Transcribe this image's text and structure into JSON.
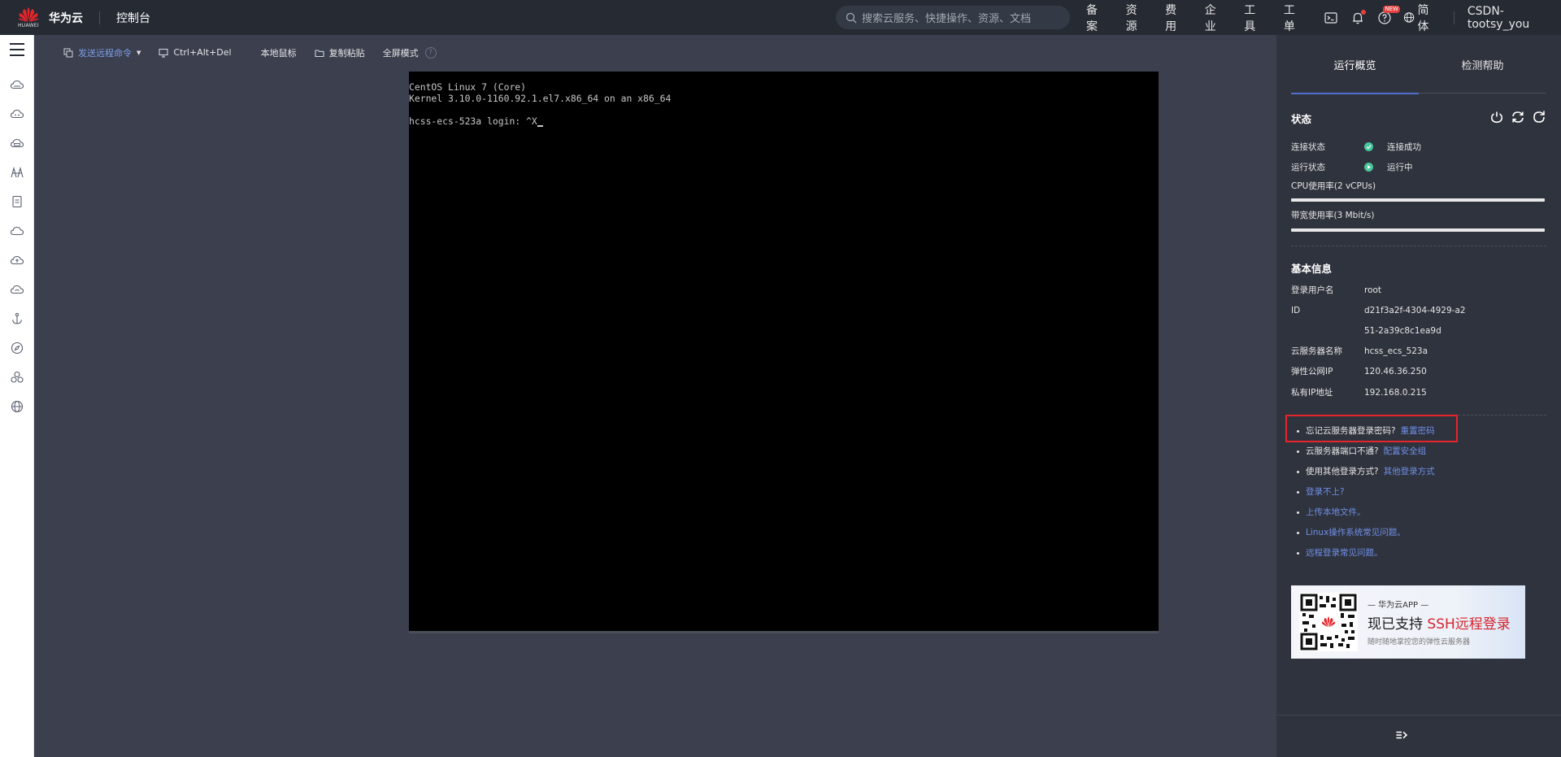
{
  "header": {
    "brand": "华为云",
    "logo_text": "HUAWEI",
    "console": "控制台",
    "search_placeholder": "搜索云服务、快捷操作、资源、文档",
    "nav": [
      "备案",
      "资源",
      "费用",
      "企业",
      "工具",
      "工单"
    ],
    "icons": [
      "terminal-icon",
      "bell-icon",
      "help-icon"
    ],
    "new_badge": "NEW",
    "language": "简体",
    "user": "CSDN-tootsy_you"
  },
  "sidebar": {
    "icons": [
      "menu-icon",
      "cloud-icon",
      "cloud-icon",
      "cloud-storage-icon",
      "network-icon",
      "document-icon",
      "cloud-icon",
      "cloud-upload-icon",
      "cloud-download-icon",
      "anchor-icon",
      "compass-icon",
      "cluster-icon",
      "globe-icon"
    ]
  },
  "toolbar": {
    "send_command": "发送远程命令",
    "ctrl_alt_del": "Ctrl+Alt+Del",
    "local_mouse": "本地鼠标",
    "copy_paste": "复制粘贴",
    "fullscreen": "全屏模式",
    "help": "?"
  },
  "terminal": {
    "line1": "CentOS Linux 7 (Core)",
    "line2": "Kernel 3.10.0-1160.92.1.el7.x86_64 on an x86_64",
    "line3": "",
    "line4": "hcss-ecs-523a login: ^X"
  },
  "panel": {
    "tabs": [
      "运行概览",
      "检测帮助"
    ],
    "status_title": "状态",
    "connection_label": "连接状态",
    "connection_value": "连接成功",
    "running_label": "运行状态",
    "running_value": "运行中",
    "cpu_label": "CPU使用率(2 vCPUs)",
    "cpu_usage": 0.0,
    "bandwidth_label": "带宽使用率(3 Mbit/s)",
    "bandwidth_usage": 0.0,
    "basic_title": "基本信息",
    "info": [
      {
        "k": "登录用户名",
        "v": "root"
      },
      {
        "k": "ID",
        "v": "d21f3a2f-4304-4929-a251-2a39c8c1ea9d"
      },
      {
        "k": "云服务器名称",
        "v": "hcss_ecs_523a"
      },
      {
        "k": "弹性公网IP",
        "v": "120.46.36.250"
      },
      {
        "k": "私有IP地址",
        "v": "192.168.0.215"
      }
    ],
    "tips": [
      {
        "q": "忘记云服务器登录密码?",
        "link": "重置密码"
      },
      {
        "q": "云服务器端口不通?",
        "link": "配置安全组"
      },
      {
        "q": "使用其他登录方式?",
        "link": "其他登录方式"
      },
      {
        "q": "",
        "link": "登录不上?"
      },
      {
        "q": "",
        "link": "上传本地文件。"
      },
      {
        "q": "",
        "link": "Linux操作系统常见问题。"
      },
      {
        "q": "",
        "link": "远程登录常见问题。"
      }
    ],
    "banner": {
      "t1": "— 华为云APP —",
      "t2a": "现已支持 ",
      "t2b": "SSH远程登录",
      "t3": "随时随地掌控您的弹性云服务器"
    }
  },
  "colors": {
    "topbar": "#252a33",
    "main_bg": "#3b3f4e",
    "panel_bg": "#2f333e",
    "accent": "#526ecc",
    "link": "#6f8fe6",
    "success": "#48c79c",
    "highlight": "#e6252b"
  }
}
